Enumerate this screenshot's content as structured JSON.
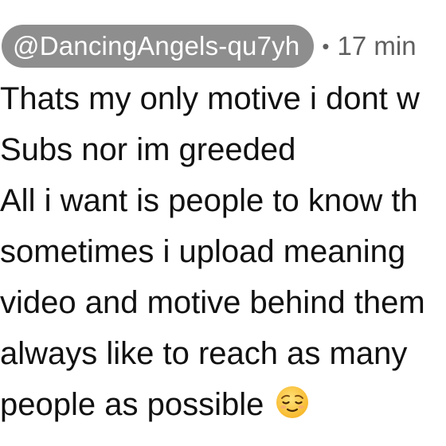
{
  "comment": {
    "author_handle": "@DancingAngels-qu7yh",
    "separator": "•",
    "timestamp": "17 min",
    "lines": [
      "Thats my only motive i dont w",
      "Subs nor im greeded",
      "All i want is people to know th",
      "sometimes i upload meaning",
      "video and motive behind them",
      "always like to reach as many",
      "people as possible"
    ],
    "emoji_name": "relieved-face-emoji"
  }
}
